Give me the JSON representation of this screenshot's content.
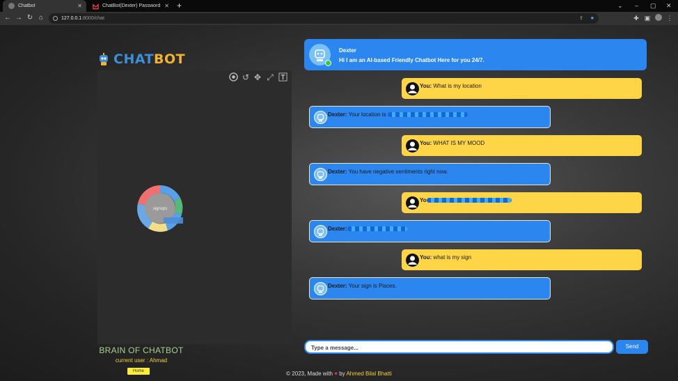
{
  "browser": {
    "tabs": [
      {
        "title": "Chatbot",
        "active": true
      },
      {
        "title": "ChatBot(Dexter) Password Chang",
        "active": false
      }
    ],
    "new_tab": "+",
    "url_host": "127.0.0.1",
    "url_path": ":8000/chat",
    "window_controls": {
      "minimize": "–",
      "maximize": "▢",
      "close": "✕"
    }
  },
  "colors": {
    "accent_blue": "#2b86f0",
    "user_bubble": "#fdd546",
    "brain_title": "#a8d08d",
    "user_highlight": "#f5d135"
  },
  "sidebar": {
    "logo_text_part1": "CHAT",
    "logo_text_part2": "BOT",
    "graph_center_label": "signups",
    "graph_toolbar_icons": [
      "camera-icon",
      "undo-icon",
      "move-icon",
      "expand-icon",
      "text-icon"
    ],
    "brain_title": "BRAIN OF CHATBOT",
    "current_user": "current user : Ahmad",
    "home_button": "Home"
  },
  "chat": {
    "header": {
      "bot_name": "Dexter",
      "greeting": "Hi I am an AI-based Friendly Chatbot Here for you 24/7."
    },
    "messages": [
      {
        "sender": "user",
        "who": "You:",
        "text": "What is my location"
      },
      {
        "sender": "bot",
        "who": "Dexter:",
        "text": "Your location is",
        "redacted": true
      },
      {
        "sender": "user",
        "who": "You:",
        "text": "WHAT IS MY MOOD"
      },
      {
        "sender": "bot",
        "who": "Dexter:",
        "text": "You have negative sentiments right now."
      },
      {
        "sender": "user",
        "who": "Yo",
        "text": "",
        "redacted": true
      },
      {
        "sender": "bot",
        "who": "Dexter:",
        "text": "",
        "redacted": true
      },
      {
        "sender": "user",
        "who": "You:",
        "text": "what is my sign"
      },
      {
        "sender": "bot",
        "who": "Dexter:",
        "text": "Your sign is Pisces."
      }
    ],
    "input_placeholder": "Type a message...",
    "send_label": "Send"
  },
  "footer": {
    "prefix": "© 2023, Made with",
    "heart": "♥",
    "by": "by",
    "author": "Ahmed Bilal Bhatti"
  }
}
